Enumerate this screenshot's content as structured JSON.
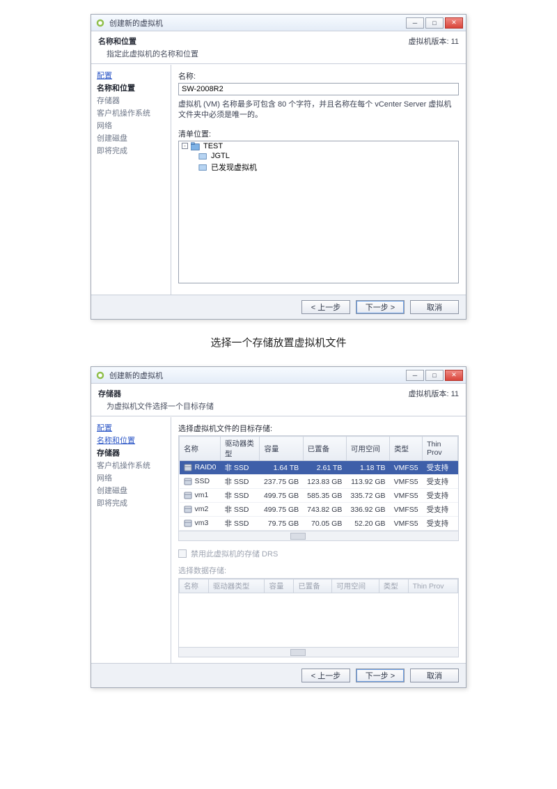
{
  "common": {
    "window_title": "创建新的虚拟机",
    "vm_version_label": "虚拟机版本:",
    "vm_version_value": "11",
    "buttons": {
      "back": "< 上一步",
      "next": "下一步 >",
      "cancel": "取消"
    }
  },
  "caption_middle": "选择一个存储放置虚拟机文件",
  "dialog1": {
    "header_title": "名称和位置",
    "header_sub": "指定此虚拟机的名称和位置",
    "sidebar": [
      {
        "label": "配置",
        "kind": "link"
      },
      {
        "label": "名称和位置",
        "kind": "active"
      },
      {
        "label": "存储器",
        "kind": "plain"
      },
      {
        "label": "客户机操作系统",
        "kind": "plain"
      },
      {
        "label": "网络",
        "kind": "plain"
      },
      {
        "label": "创建磁盘",
        "kind": "plain"
      },
      {
        "label": "即将完成",
        "kind": "plain"
      }
    ],
    "name_label": "名称:",
    "name_value": "SW-2008R2",
    "hint": "虚拟机 (VM) 名称最多可包含 80 个字符，并且名称在每个 vCenter Server 虚拟机文件夹中必须是唯一的。",
    "inv_label": "清单位置:",
    "tree": {
      "root": "TEST",
      "children": [
        "JGTL",
        "已发现虚拟机"
      ]
    }
  },
  "dialog2": {
    "header_title": "存储器",
    "header_sub": "为虚拟机文件选择一个目标存储",
    "sidebar": [
      {
        "label": "配置",
        "kind": "link"
      },
      {
        "label": "名称和位置",
        "kind": "link"
      },
      {
        "label": "存储器",
        "kind": "active"
      },
      {
        "label": "客户机操作系统",
        "kind": "plain"
      },
      {
        "label": "网络",
        "kind": "plain"
      },
      {
        "label": "创建磁盘",
        "kind": "plain"
      },
      {
        "label": "即将完成",
        "kind": "plain"
      }
    ],
    "list_label": "选择虚拟机文件的目标存储:",
    "columns": [
      "名称",
      "驱动器类型",
      "容量",
      "已置备",
      "可用空间",
      "类型",
      "Thin Prov"
    ],
    "rows": [
      {
        "name": "RAID0",
        "drv": "非 SSD",
        "cap": "1.64 TB",
        "prov": "2.61 TB",
        "free": "1.18 TB",
        "type": "VMFS5",
        "thin": "受支持",
        "selected": true
      },
      {
        "name": "SSD",
        "drv": "非 SSD",
        "cap": "237.75 GB",
        "prov": "123.83 GB",
        "free": "113.92 GB",
        "type": "VMFS5",
        "thin": "受支持"
      },
      {
        "name": "vm1",
        "drv": "非 SSD",
        "cap": "499.75 GB",
        "prov": "585.35 GB",
        "free": "335.72 GB",
        "type": "VMFS5",
        "thin": "受支持"
      },
      {
        "name": "vm2",
        "drv": "非 SSD",
        "cap": "499.75 GB",
        "prov": "743.82 GB",
        "free": "336.92 GB",
        "type": "VMFS5",
        "thin": "受支持"
      },
      {
        "name": "vm3",
        "drv": "非 SSD",
        "cap": "79.75 GB",
        "prov": "70.05 GB",
        "free": "52.20 GB",
        "type": "VMFS5",
        "thin": "受支持"
      }
    ],
    "drs_checkbox": "禁用此虚拟机的存储 DRS",
    "sublist_label": "选择数据存储:",
    "sub_columns": [
      "名称",
      "驱动器类型",
      "容量",
      "已置备",
      "可用空间",
      "类型",
      "Thin Prov"
    ]
  }
}
